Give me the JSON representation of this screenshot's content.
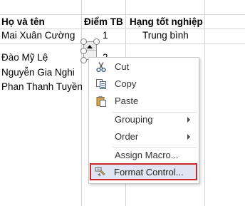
{
  "sheet": {
    "headers": {
      "name": "Họ và tên",
      "score": "Điểm TB",
      "rank": "Hạng tốt nghiệp"
    },
    "rows": [
      {
        "name": "Mai Xuân Cường",
        "score": "1",
        "rank": "Trung bình"
      },
      {
        "name": "Đào Mỹ Lệ",
        "score": "2",
        "rank": ""
      },
      {
        "name": "Nguyễn Gia Nghi",
        "score": "",
        "rank": ""
      },
      {
        "name": "Phan Thanh Tuyền",
        "score": "",
        "rank": ""
      }
    ]
  },
  "context_menu": {
    "items": [
      {
        "label": "Cut",
        "icon": "scissors-icon"
      },
      {
        "label": "Copy",
        "icon": "copy-icon"
      },
      {
        "label": "Paste",
        "icon": "paste-icon"
      },
      {
        "label": "Grouping",
        "icon": "",
        "submenu": true
      },
      {
        "label": "Order",
        "icon": "",
        "submenu": true
      },
      {
        "label": "Assign Macro...",
        "icon": ""
      },
      {
        "label": "Format Control...",
        "icon": "format-control-icon",
        "highlighted": true
      }
    ]
  },
  "colors": {
    "grid": "#d4d4d4",
    "highlight_border": "#d0252b",
    "highlight_bg": "#dde6f2"
  }
}
